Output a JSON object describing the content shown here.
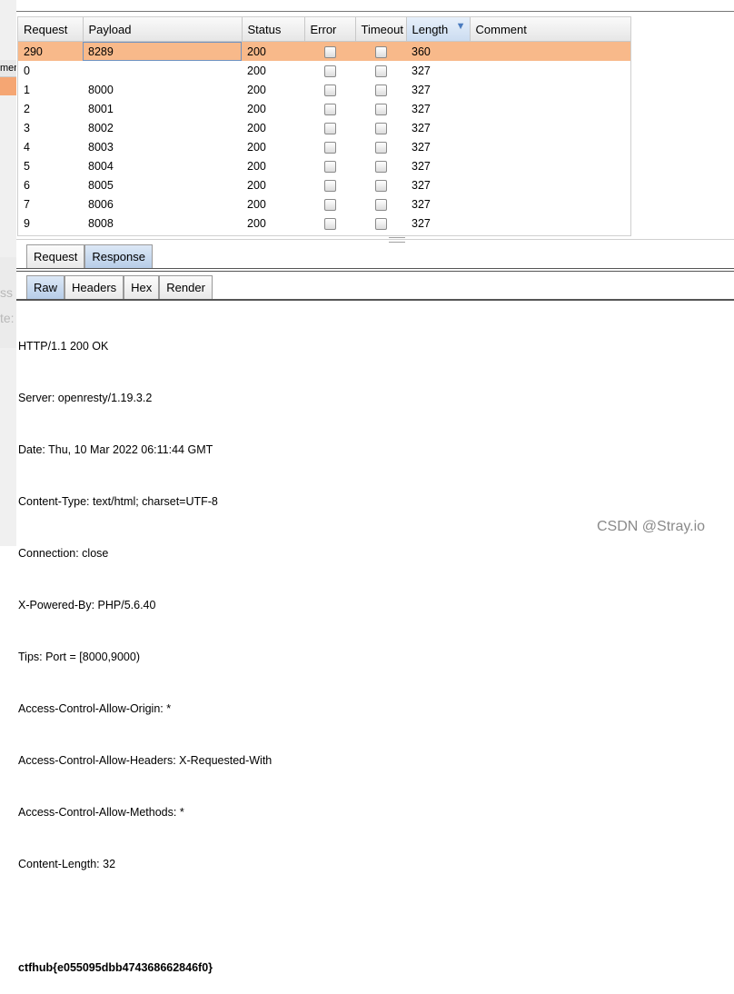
{
  "gutter": {
    "label_fragment": "ment",
    "faded_fragment_1": "ss",
    "faded_fragment_2": "te:"
  },
  "results_table": {
    "columns": [
      "Request",
      "Payload",
      "Status",
      "Error",
      "Timeout",
      "Length",
      "Comment"
    ],
    "sort_indicator": "▼",
    "rows": [
      {
        "request": "290",
        "payload": "8289",
        "status": "200",
        "length": "360",
        "comment": ""
      },
      {
        "request": "0",
        "payload": "",
        "status": "200",
        "length": "327",
        "comment": ""
      },
      {
        "request": "1",
        "payload": "8000",
        "status": "200",
        "length": "327",
        "comment": ""
      },
      {
        "request": "2",
        "payload": "8001",
        "status": "200",
        "length": "327",
        "comment": ""
      },
      {
        "request": "3",
        "payload": "8002",
        "status": "200",
        "length": "327",
        "comment": ""
      },
      {
        "request": "4",
        "payload": "8003",
        "status": "200",
        "length": "327",
        "comment": ""
      },
      {
        "request": "5",
        "payload": "8004",
        "status": "200",
        "length": "327",
        "comment": ""
      },
      {
        "request": "6",
        "payload": "8005",
        "status": "200",
        "length": "327",
        "comment": ""
      },
      {
        "request": "7",
        "payload": "8006",
        "status": "200",
        "length": "327",
        "comment": ""
      },
      {
        "request": "9",
        "payload": "8008",
        "status": "200",
        "length": "327",
        "comment": ""
      }
    ]
  },
  "message_tabs": {
    "request_label": "Request",
    "response_label": "Response",
    "active": "Response"
  },
  "view_tabs": {
    "raw_label": "Raw",
    "headers_label": "Headers",
    "hex_label": "Hex",
    "render_label": "Render",
    "active": "Raw"
  },
  "response_lines": [
    "HTTP/1.1 200 OK",
    "Server: openresty/1.19.3.2",
    "Date: Thu, 10 Mar 2022 06:11:44 GMT",
    "Content-Type: text/html; charset=UTF-8",
    "Connection: close",
    "X-Powered-By: PHP/5.6.40",
    "Tips: Port = [8000,9000)",
    "Access-Control-Allow-Origin: *",
    "Access-Control-Allow-Headers: X-Requested-With",
    "Access-Control-Allow-Methods: *",
    "Content-Length: 32",
    "",
    "ctfhub{e055095dbb474368662846f0}"
  ],
  "watermark": "CSDN @Stray.io",
  "colors": {
    "selected_row": "#f8b98a",
    "active_tab": "#b7cde8"
  }
}
